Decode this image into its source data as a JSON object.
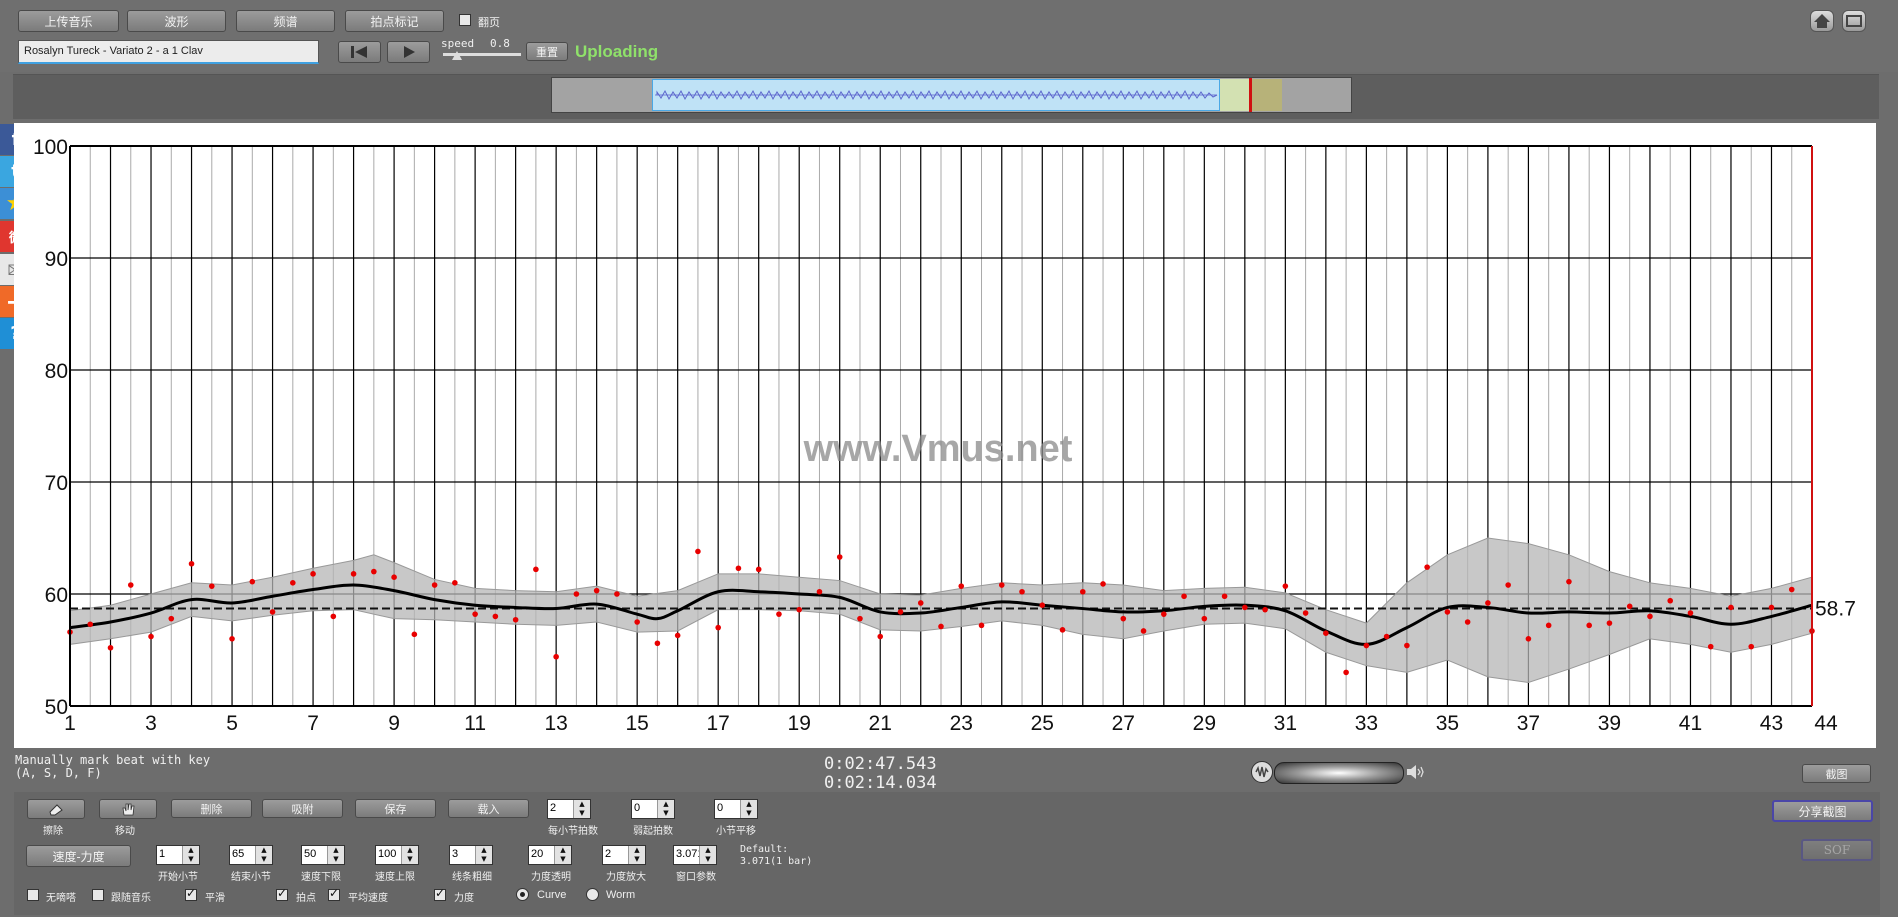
{
  "toolbar": {
    "upload_label": "上传音乐",
    "waveform_label": "波形",
    "spectrum_label": "频谱",
    "beat_mark_label": "拍点标记",
    "follow_label": "翻页",
    "song_title": "Rosalyn Tureck - Variato 2 - a 1 Clav",
    "speed_label": "speed",
    "speed_value": "0.8",
    "reset_label": "重置",
    "status": "Uploading"
  },
  "chart_data": {
    "type": "scatter",
    "xlabel": "",
    "ylabel": "",
    "xlim": [
      1,
      44
    ],
    "ylim": [
      50,
      100
    ],
    "x_ticks": [
      1,
      3,
      5,
      7,
      9,
      11,
      13,
      15,
      17,
      19,
      21,
      23,
      25,
      27,
      29,
      31,
      33,
      35,
      37,
      39,
      41,
      43,
      44
    ],
    "y_ticks": [
      50,
      60,
      70,
      80,
      90,
      100
    ],
    "average": 58.7,
    "average_label": "58.7",
    "watermark": "www.Vmus.net",
    "grid": true,
    "points": [
      [
        1,
        56.6
      ],
      [
        1.5,
        57.3
      ],
      [
        2,
        55.2
      ],
      [
        2.5,
        60.8
      ],
      [
        3,
        56.2
      ],
      [
        3.5,
        57.8
      ],
      [
        4,
        62.7
      ],
      [
        4.5,
        60.7
      ],
      [
        5,
        56.0
      ],
      [
        5.5,
        61.1
      ],
      [
        6,
        58.4
      ],
      [
        6.5,
        61.0
      ],
      [
        7,
        61.8
      ],
      [
        7.5,
        58.0
      ],
      [
        8,
        61.8
      ],
      [
        8.5,
        62.0
      ],
      [
        9,
        61.5
      ],
      [
        9.5,
        56.4
      ],
      [
        10,
        60.8
      ],
      [
        10.5,
        61.0
      ],
      [
        11,
        58.2
      ],
      [
        11.5,
        58.0
      ],
      [
        12,
        57.7
      ],
      [
        12.5,
        62.2
      ],
      [
        13,
        54.4
      ],
      [
        13.5,
        60.0
      ],
      [
        14,
        60.3
      ],
      [
        14.5,
        60.0
      ],
      [
        15,
        57.5
      ],
      [
        15.5,
        55.6
      ],
      [
        16,
        56.3
      ],
      [
        16.5,
        63.8
      ],
      [
        17,
        57.0
      ],
      [
        17.5,
        62.3
      ],
      [
        18,
        62.2
      ],
      [
        18.5,
        58.2
      ],
      [
        19,
        58.6
      ],
      [
        19.5,
        60.2
      ],
      [
        20,
        63.3
      ],
      [
        20.5,
        57.8
      ],
      [
        21,
        56.2
      ],
      [
        21.5,
        58.4
      ],
      [
        22,
        59.2
      ],
      [
        22.5,
        57.1
      ],
      [
        23,
        60.7
      ],
      [
        23.5,
        57.2
      ],
      [
        24,
        60.8
      ],
      [
        24.5,
        60.2
      ],
      [
        25,
        59.0
      ],
      [
        25.5,
        56.8
      ],
      [
        26,
        60.2
      ],
      [
        26.5,
        60.9
      ],
      [
        27,
        57.8
      ],
      [
        27.5,
        56.7
      ],
      [
        28,
        58.2
      ],
      [
        28.5,
        59.8
      ],
      [
        29,
        57.8
      ],
      [
        29.5,
        59.8
      ],
      [
        30,
        58.8
      ],
      [
        30.5,
        58.6
      ],
      [
        31,
        60.7
      ],
      [
        31.5,
        58.3
      ],
      [
        32,
        56.5
      ],
      [
        32.5,
        53.0
      ],
      [
        33,
        55.4
      ],
      [
        33.5,
        56.2
      ],
      [
        34,
        55.4
      ],
      [
        34.5,
        62.4
      ],
      [
        35,
        58.4
      ],
      [
        35.5,
        57.5
      ],
      [
        36,
        59.2
      ],
      [
        36.5,
        60.8
      ],
      [
        37,
        56.0
      ],
      [
        37.5,
        57.2
      ],
      [
        38,
        61.1
      ],
      [
        38.5,
        57.2
      ],
      [
        39,
        57.4
      ],
      [
        39.5,
        58.9
      ],
      [
        40,
        58.0
      ],
      [
        40.5,
        59.4
      ],
      [
        41,
        58.3
      ],
      [
        41.5,
        55.3
      ],
      [
        42,
        58.8
      ],
      [
        42.5,
        55.3
      ],
      [
        43,
        58.8
      ],
      [
        43.5,
        60.4
      ],
      [
        44,
        56.7
      ]
    ],
    "trend": [
      [
        1,
        57.0
      ],
      [
        2,
        57.5
      ],
      [
        3,
        58.3
      ],
      [
        4,
        59.5
      ],
      [
        5,
        59.2
      ],
      [
        6,
        59.8
      ],
      [
        7,
        60.4
      ],
      [
        8,
        60.8
      ],
      [
        9,
        60.3
      ],
      [
        10,
        59.5
      ],
      [
        11,
        59.0
      ],
      [
        12,
        58.8
      ],
      [
        13,
        58.7
      ],
      [
        14,
        59.1
      ],
      [
        15,
        58.2
      ],
      [
        15.5,
        57.8
      ],
      [
        16,
        58.5
      ],
      [
        17,
        60.2
      ],
      [
        18,
        60.2
      ],
      [
        19,
        60.0
      ],
      [
        20,
        59.7
      ],
      [
        21,
        58.4
      ],
      [
        22,
        58.3
      ],
      [
        23,
        58.8
      ],
      [
        24,
        59.3
      ],
      [
        25,
        59.0
      ],
      [
        26,
        58.7
      ],
      [
        27,
        58.4
      ],
      [
        28,
        58.5
      ],
      [
        29,
        58.9
      ],
      [
        30,
        59.0
      ],
      [
        31,
        58.5
      ],
      [
        32,
        56.7
      ],
      [
        33,
        55.5
      ],
      [
        34,
        57.0
      ],
      [
        35,
        58.8
      ],
      [
        36,
        58.8
      ],
      [
        37,
        58.3
      ],
      [
        38,
        58.4
      ],
      [
        39,
        58.3
      ],
      [
        40,
        58.5
      ],
      [
        41,
        58.0
      ],
      [
        42,
        57.3
      ],
      [
        43,
        58.0
      ],
      [
        44,
        59.0
      ]
    ],
    "band_upper": [
      [
        1,
        58.5
      ],
      [
        2,
        59.0
      ],
      [
        3,
        60.0
      ],
      [
        4,
        61.0
      ],
      [
        5,
        60.8
      ],
      [
        6,
        61.5
      ],
      [
        7,
        62.3
      ],
      [
        8,
        63.0
      ],
      [
        8.5,
        63.5
      ],
      [
        9,
        62.8
      ],
      [
        10,
        61.3
      ],
      [
        11,
        60.5
      ],
      [
        12,
        60.3
      ],
      [
        13,
        60.2
      ],
      [
        14,
        60.7
      ],
      [
        15,
        59.8
      ],
      [
        16,
        60.3
      ],
      [
        17,
        61.8
      ],
      [
        18,
        61.8
      ],
      [
        19,
        61.5
      ],
      [
        20,
        61.2
      ],
      [
        21,
        60.0
      ],
      [
        22,
        59.9
      ],
      [
        23,
        60.5
      ],
      [
        24,
        61.0
      ],
      [
        25,
        60.8
      ],
      [
        26,
        61.0
      ],
      [
        27,
        60.8
      ],
      [
        28,
        60.3
      ],
      [
        29,
        60.5
      ],
      [
        30,
        60.6
      ],
      [
        31,
        60.1
      ],
      [
        32,
        58.6
      ],
      [
        33,
        57.4
      ],
      [
        34,
        61.0
      ],
      [
        35,
        63.5
      ],
      [
        36,
        65.0
      ],
      [
        37,
        64.5
      ],
      [
        38,
        63.5
      ],
      [
        39,
        62.0
      ],
      [
        40,
        61.0
      ],
      [
        41,
        60.5
      ],
      [
        42,
        59.8
      ],
      [
        43,
        60.5
      ],
      [
        44,
        61.5
      ]
    ],
    "band_lower": [
      [
        1,
        55.5
      ],
      [
        2,
        56.0
      ],
      [
        3,
        56.6
      ],
      [
        4,
        58.0
      ],
      [
        5,
        57.6
      ],
      [
        6,
        58.1
      ],
      [
        7,
        58.5
      ],
      [
        8,
        58.6
      ],
      [
        9,
        57.8
      ],
      [
        10,
        57.7
      ],
      [
        11,
        57.5
      ],
      [
        12,
        57.3
      ],
      [
        13,
        57.2
      ],
      [
        14,
        57.5
      ],
      [
        15,
        56.6
      ],
      [
        16,
        56.7
      ],
      [
        17,
        58.6
      ],
      [
        18,
        58.6
      ],
      [
        19,
        58.5
      ],
      [
        20,
        58.2
      ],
      [
        21,
        56.8
      ],
      [
        22,
        56.7
      ],
      [
        23,
        57.1
      ],
      [
        24,
        57.6
      ],
      [
        25,
        57.2
      ],
      [
        26,
        56.4
      ],
      [
        27,
        56.0
      ],
      [
        28,
        56.7
      ],
      [
        29,
        57.3
      ],
      [
        30,
        57.4
      ],
      [
        31,
        56.9
      ],
      [
        32,
        54.8
      ],
      [
        33,
        53.6
      ],
      [
        34,
        53.0
      ],
      [
        35,
        54.1
      ],
      [
        36,
        52.6
      ],
      [
        37,
        52.1
      ],
      [
        38,
        53.3
      ],
      [
        39,
        54.6
      ],
      [
        40,
        56.0
      ],
      [
        41,
        55.5
      ],
      [
        42,
        54.8
      ],
      [
        43,
        55.5
      ],
      [
        44,
        56.5
      ]
    ]
  },
  "info": {
    "hint_line1": "Manually mark beat with key",
    "hint_line2": "(A, S, D, F)",
    "time1": "0:02:47.543",
    "time2": "0:02:14.034",
    "screenshot_label": "截图"
  },
  "panel": {
    "erase_label": "擦除",
    "move_label": "移动",
    "delete_label": "删除",
    "snap_label": "吸附",
    "save_label": "保存",
    "load_label": "载入",
    "tempo_dynamics_label": "速度-力度",
    "split_screenshot_label": "分享截图",
    "disabled_btn_label": "SOF",
    "beats_per_bar": "2",
    "beats_per_bar_label": "每小节拍数",
    "start_beat": "0",
    "start_beat_label": "弱起拍数",
    "bar_offset": "0",
    "bar_offset_label": "小节平移",
    "start_bar": "1",
    "start_bar_label": "开始小节",
    "end_bar": "65",
    "end_bar_label": "结束小节",
    "tempo_min": "50",
    "tempo_min_label": "速度下限",
    "tempo_max": "100",
    "tempo_max_label": "速度上限",
    "line_width": "3",
    "line_width_label": "线条粗细",
    "dyn_alpha": "20",
    "dyn_alpha_label": "力度透明",
    "dyn_scale": "2",
    "dyn_scale_label": "力度放大",
    "window": "3.071",
    "window_label": "窗口参数",
    "default_line1": "Default:",
    "default_line2": "3.071(1 bar)",
    "no_click_label": "无嘀嗒",
    "follow_music_label": "跟随音乐",
    "smooth_label": "平滑",
    "beats_label": "拍点",
    "avg_tempo_label": "平均速度",
    "dynamics_label": "力度",
    "curve_label": "Curve",
    "worm_label": "Worm"
  }
}
